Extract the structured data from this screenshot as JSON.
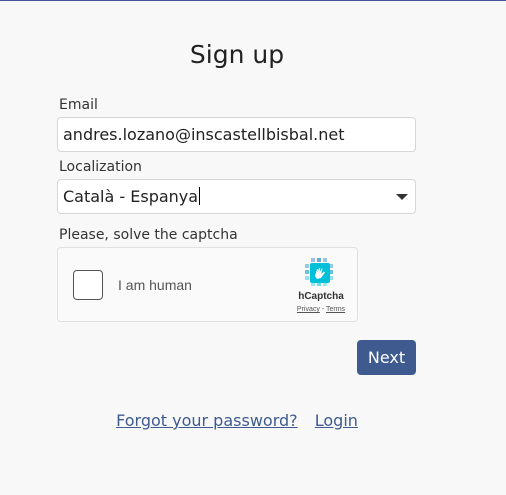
{
  "title": "Sign up",
  "email": {
    "label": "Email",
    "value": "andres.lozano@inscastellbisbal.net"
  },
  "localization": {
    "label": "Localization",
    "selected": "Català - Espanya"
  },
  "captcha": {
    "prompt": "Please, solve the captcha",
    "checkbox_label": "I am human",
    "brand": "hCaptcha",
    "privacy": "Privacy",
    "separator": "-",
    "terms": "Terms"
  },
  "next_button": "Next",
  "links": {
    "forgot_password": "Forgot your password?",
    "login": "Login"
  },
  "colors": {
    "accent": "#3e5a8f",
    "background": "#f8f8f8"
  }
}
